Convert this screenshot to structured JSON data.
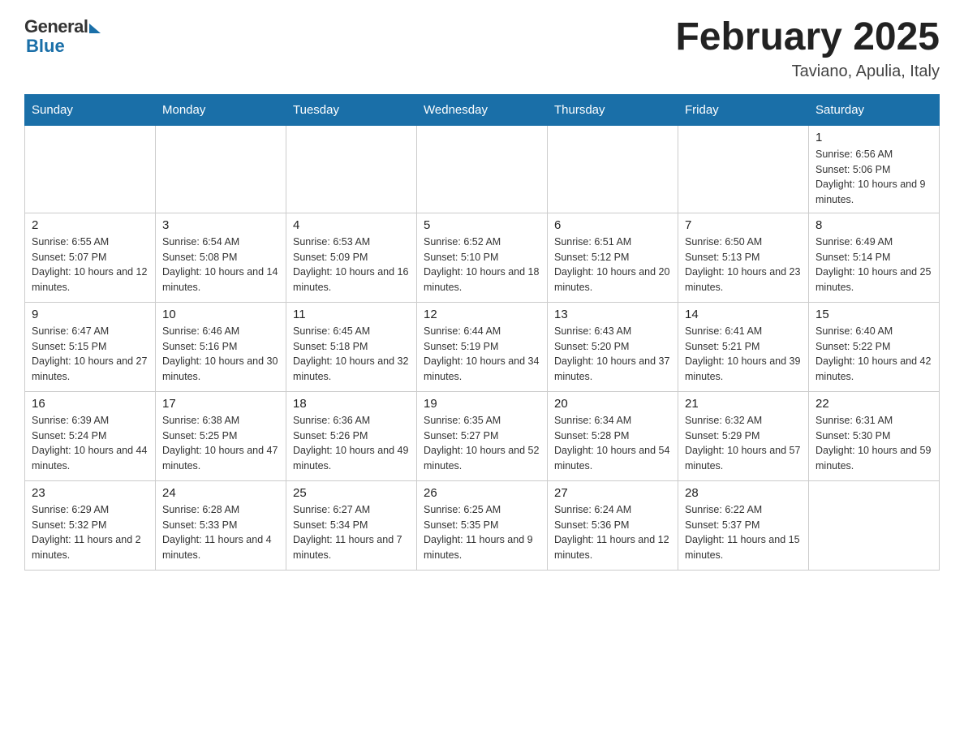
{
  "header": {
    "logo_general": "General",
    "logo_blue": "Blue",
    "month_title": "February 2025",
    "location": "Taviano, Apulia, Italy"
  },
  "days_of_week": [
    "Sunday",
    "Monday",
    "Tuesday",
    "Wednesday",
    "Thursday",
    "Friday",
    "Saturday"
  ],
  "weeks": [
    [
      {
        "day": "",
        "info": ""
      },
      {
        "day": "",
        "info": ""
      },
      {
        "day": "",
        "info": ""
      },
      {
        "day": "",
        "info": ""
      },
      {
        "day": "",
        "info": ""
      },
      {
        "day": "",
        "info": ""
      },
      {
        "day": "1",
        "info": "Sunrise: 6:56 AM\nSunset: 5:06 PM\nDaylight: 10 hours and 9 minutes."
      }
    ],
    [
      {
        "day": "2",
        "info": "Sunrise: 6:55 AM\nSunset: 5:07 PM\nDaylight: 10 hours and 12 minutes."
      },
      {
        "day": "3",
        "info": "Sunrise: 6:54 AM\nSunset: 5:08 PM\nDaylight: 10 hours and 14 minutes."
      },
      {
        "day": "4",
        "info": "Sunrise: 6:53 AM\nSunset: 5:09 PM\nDaylight: 10 hours and 16 minutes."
      },
      {
        "day": "5",
        "info": "Sunrise: 6:52 AM\nSunset: 5:10 PM\nDaylight: 10 hours and 18 minutes."
      },
      {
        "day": "6",
        "info": "Sunrise: 6:51 AM\nSunset: 5:12 PM\nDaylight: 10 hours and 20 minutes."
      },
      {
        "day": "7",
        "info": "Sunrise: 6:50 AM\nSunset: 5:13 PM\nDaylight: 10 hours and 23 minutes."
      },
      {
        "day": "8",
        "info": "Sunrise: 6:49 AM\nSunset: 5:14 PM\nDaylight: 10 hours and 25 minutes."
      }
    ],
    [
      {
        "day": "9",
        "info": "Sunrise: 6:47 AM\nSunset: 5:15 PM\nDaylight: 10 hours and 27 minutes."
      },
      {
        "day": "10",
        "info": "Sunrise: 6:46 AM\nSunset: 5:16 PM\nDaylight: 10 hours and 30 minutes."
      },
      {
        "day": "11",
        "info": "Sunrise: 6:45 AM\nSunset: 5:18 PM\nDaylight: 10 hours and 32 minutes."
      },
      {
        "day": "12",
        "info": "Sunrise: 6:44 AM\nSunset: 5:19 PM\nDaylight: 10 hours and 34 minutes."
      },
      {
        "day": "13",
        "info": "Sunrise: 6:43 AM\nSunset: 5:20 PM\nDaylight: 10 hours and 37 minutes."
      },
      {
        "day": "14",
        "info": "Sunrise: 6:41 AM\nSunset: 5:21 PM\nDaylight: 10 hours and 39 minutes."
      },
      {
        "day": "15",
        "info": "Sunrise: 6:40 AM\nSunset: 5:22 PM\nDaylight: 10 hours and 42 minutes."
      }
    ],
    [
      {
        "day": "16",
        "info": "Sunrise: 6:39 AM\nSunset: 5:24 PM\nDaylight: 10 hours and 44 minutes."
      },
      {
        "day": "17",
        "info": "Sunrise: 6:38 AM\nSunset: 5:25 PM\nDaylight: 10 hours and 47 minutes."
      },
      {
        "day": "18",
        "info": "Sunrise: 6:36 AM\nSunset: 5:26 PM\nDaylight: 10 hours and 49 minutes."
      },
      {
        "day": "19",
        "info": "Sunrise: 6:35 AM\nSunset: 5:27 PM\nDaylight: 10 hours and 52 minutes."
      },
      {
        "day": "20",
        "info": "Sunrise: 6:34 AM\nSunset: 5:28 PM\nDaylight: 10 hours and 54 minutes."
      },
      {
        "day": "21",
        "info": "Sunrise: 6:32 AM\nSunset: 5:29 PM\nDaylight: 10 hours and 57 minutes."
      },
      {
        "day": "22",
        "info": "Sunrise: 6:31 AM\nSunset: 5:30 PM\nDaylight: 10 hours and 59 minutes."
      }
    ],
    [
      {
        "day": "23",
        "info": "Sunrise: 6:29 AM\nSunset: 5:32 PM\nDaylight: 11 hours and 2 minutes."
      },
      {
        "day": "24",
        "info": "Sunrise: 6:28 AM\nSunset: 5:33 PM\nDaylight: 11 hours and 4 minutes."
      },
      {
        "day": "25",
        "info": "Sunrise: 6:27 AM\nSunset: 5:34 PM\nDaylight: 11 hours and 7 minutes."
      },
      {
        "day": "26",
        "info": "Sunrise: 6:25 AM\nSunset: 5:35 PM\nDaylight: 11 hours and 9 minutes."
      },
      {
        "day": "27",
        "info": "Sunrise: 6:24 AM\nSunset: 5:36 PM\nDaylight: 11 hours and 12 minutes."
      },
      {
        "day": "28",
        "info": "Sunrise: 6:22 AM\nSunset: 5:37 PM\nDaylight: 11 hours and 15 minutes."
      },
      {
        "day": "",
        "info": ""
      }
    ]
  ]
}
